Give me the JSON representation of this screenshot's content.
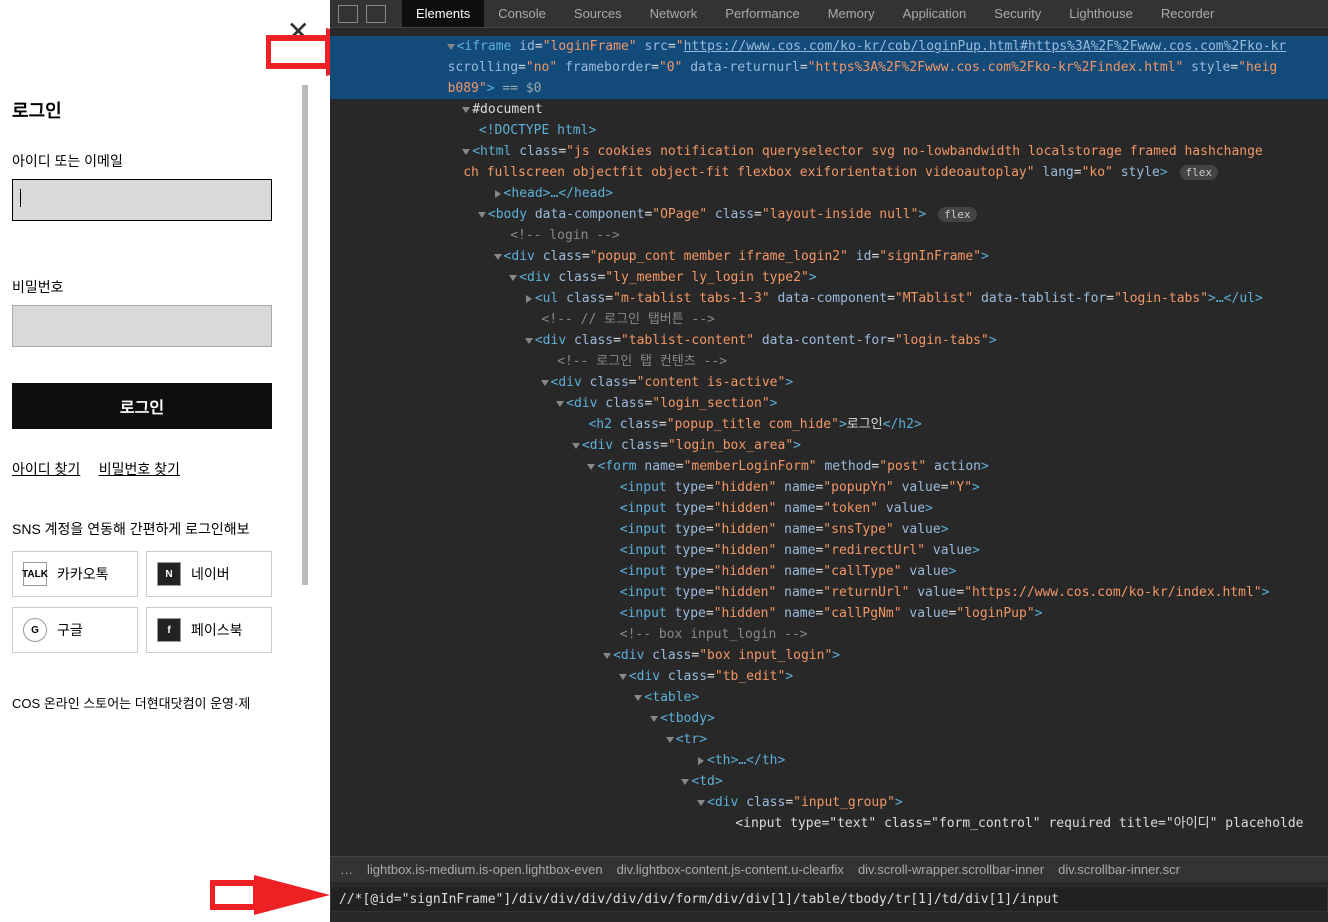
{
  "login": {
    "title": "로그인",
    "id_label": "아이디 또는 이메일",
    "pw_label": "비밀번호",
    "login_btn": "로그인",
    "find_id": "아이디 찾기",
    "find_pw": "비밀번호 찾기",
    "sns_text": "SNS 계정을 연동해 간편하게 로그인해보",
    "kakao": "카카오톡",
    "naver": "네이버",
    "google": "구글",
    "facebook": "페이스북",
    "footer": "COS 온라인 스토어는 더현대닷컴이 운영·제"
  },
  "devtools": {
    "tabs": [
      "Elements",
      "Console",
      "Sources",
      "Network",
      "Performance",
      "Memory",
      "Application",
      "Security",
      "Lighthouse",
      "Recorder"
    ],
    "active_tab": "Elements",
    "breadcrumb": [
      "…",
      "lightbox.is-medium.is-open.lightbox-even",
      "div.lightbox-content.js-content.u-clearfix",
      "div.scroll-wrapper.scrollbar-inner",
      "div.scrollbar-inner.scr"
    ],
    "xpath": "//*[@id=\"signInFrame\"]/div/div/div/div/div/form/div/div[1]/table/tbody/tr[1]/td/div[1]/input",
    "dom": {
      "iframe_id": "loginFrame",
      "iframe_src": "https://www.cos.com/ko-kr/cob/loginPup.html#https%3A%2F%2Fwww.cos.com%2Fko-kr",
      "scrolling": "no",
      "frameborder": "0",
      "returnurl": "https%3A%2F%2Fwww.cos.com%2Fko-kr%2Findex.html",
      "style_heig": "heig",
      "b089": "b089",
      "sel_eq": " == $0",
      "document": "#document",
      "doctype": "<!DOCTYPE html>",
      "html_class": "js cookies notification queryselector svg no-lowbandwidth localstorage framed hashchange",
      "html_class2": "ch fullscreen objectfit object-fit flexbox exiforientation videoautoplay",
      "html_lang": "ko",
      "flex": "flex",
      "head": "<head>…</head>",
      "body_comp": "OPage",
      "body_class": "layout-inside null",
      "login_comment": "<!-- login -->",
      "popup_class": "popup_cont member iframe_login2",
      "popup_id": "signInFrame",
      "ly_class": "ly_member ly_login type2",
      "ul_class": "m-tablist tabs-1-3",
      "ul_comp": "MTablist",
      "ul_for": "login-tabs",
      "tab_comment": "<!-- // 로그인 탭버튼 -->",
      "tablist_class": "tablist-content",
      "tablist_for": "login-tabs",
      "tabcontent_comment": "<!-- 로그인 탭 컨텐츠 -->",
      "content_class": "content is-active",
      "section_class": "login_section",
      "h2_class": "popup_title com_hide",
      "h2_text": "로그인",
      "box_class": "login_box_area",
      "form_name": "memberLoginForm",
      "form_method": "post",
      "hidden_popupYn": "popupYn",
      "hidden_popupYn_val": "Y",
      "hidden_token": "token",
      "hidden_snsType": "snsType",
      "hidden_redirectUrl": "redirectUrl",
      "hidden_callType": "callType",
      "hidden_returnUrl": "returnUrl",
      "hidden_returnUrl_val": "https://www.cos.com/ko-kr/index.html",
      "hidden_callPgNm": "callPgNm",
      "hidden_callPgNm_val": "loginPup",
      "box_comment": "<!-- box input_login -->",
      "box_login": "box input_login",
      "tb_edit": "tb_edit",
      "table": "<table>",
      "tbody": "<tbody>",
      "tr": "<tr>",
      "th": "<th>…</th>",
      "td": "<td>",
      "input_group": "input_group",
      "hl_tag": "input",
      "hl_type": "text",
      "hl_class": "form_control",
      "hl_title": "아이디",
      "hl_placeholder": "placeholde"
    }
  }
}
